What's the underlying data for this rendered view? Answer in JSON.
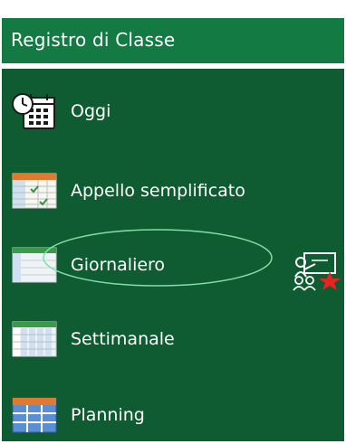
{
  "header": {
    "title": "Registro di Classe"
  },
  "menu": {
    "items": [
      {
        "label": "Oggi",
        "icon": "calendar-clock-icon"
      },
      {
        "label": "Appello semplificato",
        "icon": "attendance-sheet-icon"
      },
      {
        "label": "Giornaliero",
        "icon": "daily-register-icon"
      },
      {
        "label": "Settimanale",
        "icon": "weekly-register-icon"
      },
      {
        "label": "Planning",
        "icon": "planning-grid-icon"
      }
    ],
    "highlighted_item": "Giornaliero"
  },
  "side_action": {
    "icon": "teacher-lesson-star-icon"
  },
  "colors": {
    "header_bg": "#137a44",
    "panel_bg": "#0f5b32",
    "highlight_ellipse": "#7fe0a8",
    "star": "#e8231f"
  }
}
